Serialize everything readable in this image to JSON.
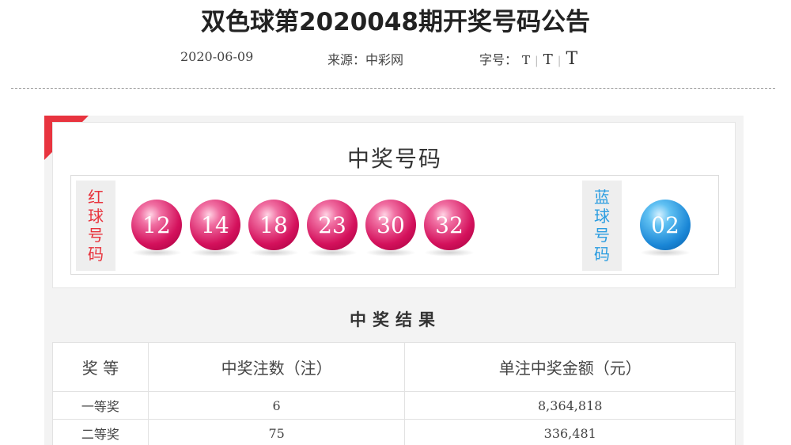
{
  "header": {
    "title": "双色球第2020048期开奖号码公告",
    "date": "2020-06-09",
    "source": "来源：中彩网",
    "font_label": "字号：",
    "font_options": [
      "T",
      "T",
      "T"
    ],
    "separator": "|"
  },
  "draw": {
    "heading": "中奖号码",
    "red_label": [
      "红",
      "球",
      "号",
      "码"
    ],
    "blue_label": [
      "蓝",
      "球",
      "号",
      "码"
    ],
    "red_balls": [
      "12",
      "14",
      "18",
      "23",
      "30",
      "32"
    ],
    "blue_ball": "02",
    "colors": {
      "red": "#d4115c",
      "blue": "#1a86d6",
      "ribbon": "#e8343f"
    }
  },
  "results": {
    "heading": "中奖结果",
    "columns": [
      "奖 等",
      "中奖注数（注）",
      "单注中奖金额（元）"
    ],
    "rows": [
      {
        "tier": "一等奖",
        "count": "6",
        "amount": "8,364,818"
      },
      {
        "tier": "二等奖",
        "count": "75",
        "amount": "336,481"
      }
    ]
  }
}
